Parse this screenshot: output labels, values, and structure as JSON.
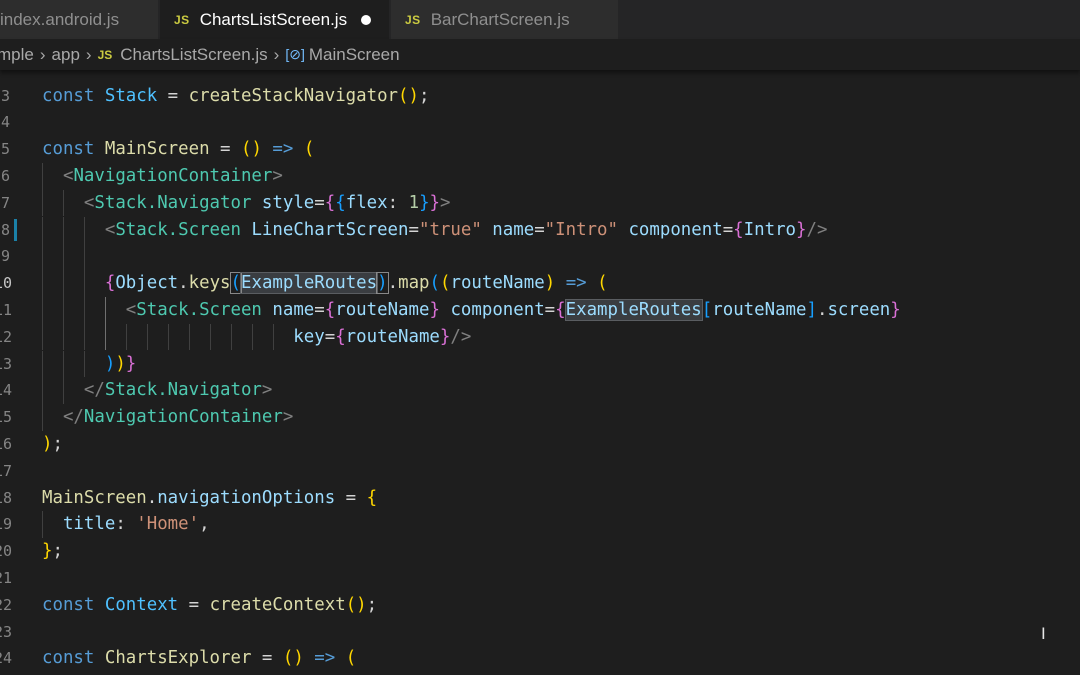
{
  "tabs": [
    {
      "label": "index.android.js",
      "icon": "",
      "active": false
    },
    {
      "label": "ChartsListScreen.js",
      "icon": "JS",
      "active": true,
      "modified": true
    },
    {
      "label": "BarChartScreen.js",
      "icon": "JS",
      "active": false
    }
  ],
  "breadcrumb": {
    "segments": [
      "mple",
      "app",
      "ChartsListScreen.js",
      "MainScreen"
    ],
    "file_icon": "JS",
    "symbol_icon": "[⊘]"
  },
  "colors": {
    "editor_bg": "#1e1e1e",
    "keyword": "#569cd6",
    "constant": "#4fc1ff",
    "function": "#dcdcaa",
    "tag": "#4ec9b0",
    "string": "#ce9178",
    "bracket_gold": "#ffd700",
    "bracket_orchid": "#da70d6",
    "bracket_blue": "#179fff"
  },
  "editor": {
    "lines": [
      {
        "num": "3",
        "guides": 0,
        "tokens": [
          [
            "kw",
            "const"
          ],
          [
            "plain",
            " "
          ],
          [
            "const",
            "Stack"
          ],
          [
            "plain",
            " = "
          ],
          [
            "func",
            "createStackNavigator"
          ],
          [
            "p1",
            "()"
          ],
          [
            "plain",
            ";"
          ]
        ]
      },
      {
        "num": "4",
        "guides": 0,
        "tokens": []
      },
      {
        "num": "5",
        "guides": 0,
        "tokens": [
          [
            "kw",
            "const"
          ],
          [
            "plain",
            " "
          ],
          [
            "func",
            "MainScreen"
          ],
          [
            "plain",
            " = "
          ],
          [
            "p1",
            "()"
          ],
          [
            "plain",
            " "
          ],
          [
            "kw",
            "=>"
          ],
          [
            "plain",
            " "
          ],
          [
            "p1",
            "("
          ]
        ]
      },
      {
        "num": "6",
        "guides": 1,
        "tokens": [
          [
            "plain",
            "  "
          ],
          [
            "tagp",
            "<"
          ],
          [
            "tag",
            "NavigationContainer"
          ],
          [
            "tagp",
            ">"
          ]
        ]
      },
      {
        "num": "7",
        "guides": 2,
        "tokens": [
          [
            "plain",
            "    "
          ],
          [
            "tagp",
            "<"
          ],
          [
            "tag",
            "Stack.Navigator"
          ],
          [
            "plain",
            " "
          ],
          [
            "attr",
            "style"
          ],
          [
            "plain",
            "="
          ],
          [
            "p2",
            "{"
          ],
          [
            "p3",
            "{"
          ],
          [
            "var",
            "flex"
          ],
          [
            "plain",
            ": "
          ],
          [
            "num",
            "1"
          ],
          [
            "p3",
            "}"
          ],
          [
            "p2",
            "}"
          ],
          [
            "tagp",
            ">"
          ]
        ]
      },
      {
        "num": "8",
        "guides": 3,
        "mark": true,
        "tokens": [
          [
            "plain",
            "      "
          ],
          [
            "tagp",
            "<"
          ],
          [
            "tag",
            "Stack.Screen"
          ],
          [
            "plain",
            " "
          ],
          [
            "attr",
            "LineChartScreen"
          ],
          [
            "plain",
            "="
          ],
          [
            "str",
            "\"true\""
          ],
          [
            "plain",
            " "
          ],
          [
            "attr",
            "name"
          ],
          [
            "plain",
            "="
          ],
          [
            "str",
            "\"Intro\""
          ],
          [
            "plain",
            " "
          ],
          [
            "attr",
            "component"
          ],
          [
            "plain",
            "="
          ],
          [
            "p2",
            "{"
          ],
          [
            "var",
            "Intro"
          ],
          [
            "p2",
            "}"
          ],
          [
            "tagp",
            "/>"
          ]
        ]
      },
      {
        "num": "9",
        "guides": 3,
        "tokens": []
      },
      {
        "num": "10",
        "guides": 3,
        "cur": true,
        "tokens": [
          [
            "plain",
            "      "
          ],
          [
            "p2",
            "{"
          ],
          [
            "var",
            "Object"
          ],
          [
            "plain",
            "."
          ],
          [
            "func",
            "keys"
          ],
          [
            "p3b",
            "("
          ],
          [
            "varhl",
            "ExampleRoutes"
          ],
          [
            "p3b",
            ")"
          ],
          [
            "plain",
            "."
          ],
          [
            "func",
            "map"
          ],
          [
            "p3",
            "("
          ],
          [
            "p1",
            "("
          ],
          [
            "var",
            "routeName"
          ],
          [
            "p1",
            ")"
          ],
          [
            "plain",
            " "
          ],
          [
            "kw",
            "=>"
          ],
          [
            "plain",
            " "
          ],
          [
            "p1",
            "("
          ]
        ]
      },
      {
        "num": "11",
        "guides": 4,
        "active_guide": 3,
        "tokens": [
          [
            "plain",
            "        "
          ],
          [
            "tagp",
            "<"
          ],
          [
            "tag",
            "Stack.Screen"
          ],
          [
            "plain",
            " "
          ],
          [
            "attr",
            "name"
          ],
          [
            "plain",
            "="
          ],
          [
            "p2",
            "{"
          ],
          [
            "var",
            "routeName"
          ],
          [
            "p2",
            "}"
          ],
          [
            "plain",
            " "
          ],
          [
            "attr",
            "component"
          ],
          [
            "plain",
            "="
          ],
          [
            "p2",
            "{"
          ],
          [
            "varhl",
            "ExampleRoutes"
          ],
          [
            "p3",
            "["
          ],
          [
            "var",
            "routeName"
          ],
          [
            "p3",
            "]"
          ],
          [
            "plain",
            "."
          ],
          [
            "var",
            "screen"
          ],
          [
            "p2",
            "}"
          ]
        ]
      },
      {
        "num": "12",
        "guides": 12,
        "active_guide": 3,
        "tokens": [
          [
            "plain",
            "                        "
          ],
          [
            "attr",
            "key"
          ],
          [
            "plain",
            "="
          ],
          [
            "p2",
            "{"
          ],
          [
            "var",
            "routeName"
          ],
          [
            "p2",
            "}"
          ],
          [
            "tagp",
            "/>"
          ]
        ]
      },
      {
        "num": "13",
        "guides": 3,
        "tokens": [
          [
            "plain",
            "      "
          ],
          [
            "p3",
            ")"
          ],
          [
            "p1",
            ")"
          ],
          [
            "p2",
            "}"
          ]
        ]
      },
      {
        "num": "14",
        "guides": 2,
        "tokens": [
          [
            "plain",
            "    "
          ],
          [
            "tagp",
            "</"
          ],
          [
            "tag",
            "Stack.Navigator"
          ],
          [
            "tagp",
            ">"
          ]
        ]
      },
      {
        "num": "15",
        "guides": 1,
        "tokens": [
          [
            "plain",
            "  "
          ],
          [
            "tagp",
            "</"
          ],
          [
            "tag",
            "NavigationContainer"
          ],
          [
            "tagp",
            ">"
          ]
        ]
      },
      {
        "num": "16",
        "guides": 0,
        "tokens": [
          [
            "p1",
            ")"
          ],
          [
            "plain",
            ";"
          ]
        ]
      },
      {
        "num": "17",
        "guides": 0,
        "tokens": []
      },
      {
        "num": "18",
        "guides": 0,
        "tokens": [
          [
            "func",
            "MainScreen"
          ],
          [
            "plain",
            "."
          ],
          [
            "var",
            "navigationOptions"
          ],
          [
            "plain",
            " = "
          ],
          [
            "p1",
            "{"
          ]
        ]
      },
      {
        "num": "19",
        "guides": 1,
        "tokens": [
          [
            "plain",
            "  "
          ],
          [
            "var",
            "title"
          ],
          [
            "plain",
            ": "
          ],
          [
            "str",
            "'Home'"
          ],
          [
            "plain",
            ","
          ]
        ]
      },
      {
        "num": "20",
        "guides": 0,
        "tokens": [
          [
            "p1",
            "}"
          ],
          [
            "plain",
            ";"
          ]
        ]
      },
      {
        "num": "21",
        "guides": 0,
        "tokens": []
      },
      {
        "num": "22",
        "guides": 0,
        "tokens": [
          [
            "kw",
            "const"
          ],
          [
            "plain",
            " "
          ],
          [
            "const",
            "Context"
          ],
          [
            "plain",
            " = "
          ],
          [
            "func",
            "createContext"
          ],
          [
            "p1",
            "()"
          ],
          [
            "plain",
            ";"
          ]
        ]
      },
      {
        "num": "23",
        "guides": 0,
        "tokens": []
      },
      {
        "num": "24",
        "guides": 0,
        "tokens": [
          [
            "kw",
            "const"
          ],
          [
            "plain",
            " "
          ],
          [
            "func",
            "ChartsExplorer"
          ],
          [
            "plain",
            " = "
          ],
          [
            "p1",
            "()"
          ],
          [
            "plain",
            " "
          ],
          [
            "kw",
            "=>"
          ],
          [
            "plain",
            " "
          ],
          [
            "p1",
            "("
          ]
        ]
      }
    ]
  },
  "mouse_cursor": "I"
}
